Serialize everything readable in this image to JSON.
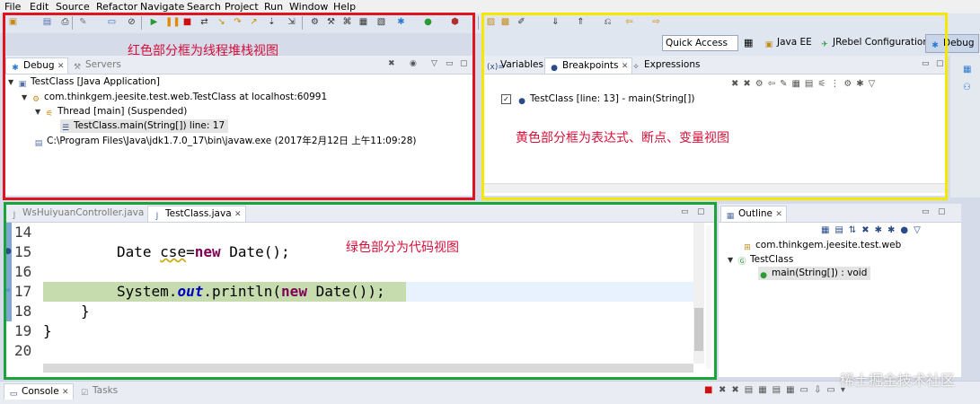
{
  "menubar": [
    "File",
    "Edit",
    "Source",
    "Refactor",
    "Navigate",
    "Search",
    "Project",
    "Run",
    "Window",
    "Help"
  ],
  "quick_access": "Quick Access",
  "perspectives": [
    "Java EE",
    "JRebel Configuration",
    "Debug"
  ],
  "debug_view": {
    "tabs": [
      "Debug",
      "Servers"
    ],
    "tree": [
      "TestClass [Java Application]",
      "com.thinkgem.jeesite.test.web.TestClass at localhost:60991",
      "Thread [main] (Suspended)",
      "TestClass.main(String[]) line: 17",
      "C:\\Program Files\\Java\\jdk1.7.0_17\\bin\\javaw.exe (2017年2月12日 上午11:09:28)"
    ],
    "annotation": "红色部分框为线程堆栈视图"
  },
  "breakpoints_view": {
    "tabs": [
      "Variables",
      "Breakpoints",
      "Expressions"
    ],
    "items": [
      "TestClass [line: 13] - main(String[])"
    ],
    "annotation": "黄色部分框为表达式、断点、变量视图"
  },
  "editor": {
    "tabs": [
      "WsHuiyuanController.java",
      "TestClass.java"
    ],
    "line_numbers": [
      "14",
      "15",
      "16",
      "17",
      "18",
      "19",
      "20"
    ],
    "code": {
      "l15_a": "Date ",
      "l15_b": "cse",
      "l15_c": "=",
      "l15_kw": "new",
      "l15_d": " Date();",
      "l17_a": "System.",
      "l17_fld": "out",
      "l17_b": ".println(",
      "l17_kw": "new",
      "l17_c": " Date());",
      "l18": "}",
      "l19": "}"
    },
    "annotation": "绿色部分为代码视图"
  },
  "outline_view": {
    "tab": "Outline",
    "items": [
      "com.thinkgem.jeesite.test.web",
      "TestClass",
      "main(String[]) : void"
    ]
  },
  "console_view": {
    "tabs": [
      "Console",
      "Tasks"
    ]
  },
  "watermark": "稀土掘金技术社区",
  "colors": {
    "red_frame": "#e0141e",
    "yellow_frame": "#f5e800",
    "green_frame": "#1aa33a",
    "annotation_text": "#d4103a"
  }
}
